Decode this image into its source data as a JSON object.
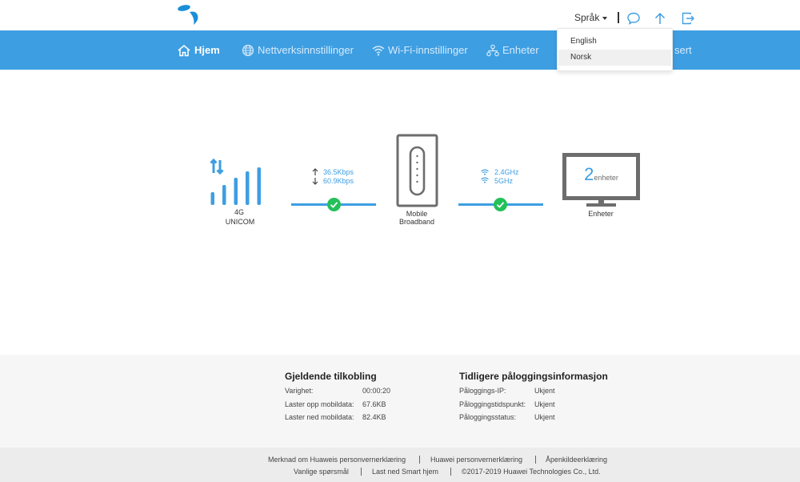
{
  "header": {
    "language_label": "Språk",
    "colors": {
      "brand": "#3e9ee2",
      "logo": "#1a8fd8"
    }
  },
  "nav": {
    "items": [
      {
        "label": "Hjem",
        "icon": "home-icon",
        "active": true
      },
      {
        "label": "Nettverksinnstillinger",
        "icon": "globe-icon"
      },
      {
        "label": "Wi-Fi-innstillinger",
        "icon": "wifi-icon"
      },
      {
        "label": "Enheter",
        "icon": "devices-icon"
      },
      {
        "label": "sert"
      }
    ]
  },
  "language_menu": {
    "options": [
      "English",
      "Norsk"
    ],
    "hovered": "Norsk"
  },
  "diagram": {
    "network": {
      "type": "4G",
      "operator": "UNICOM"
    },
    "speed": {
      "up": "36.5Kbps",
      "down": "60.9Kbps"
    },
    "router": {
      "line1": "Mobile",
      "line2": "Broadband"
    },
    "wifi": {
      "band1": "2.4GHz",
      "band2": "5GHz"
    },
    "devices": {
      "count": "2",
      "unit": "enheter",
      "label": "Enheter"
    },
    "status_color": "#24c05a"
  },
  "current_connection": {
    "title": "Gjeldende tilkobling",
    "rows": [
      {
        "key": "Varighet:",
        "value": "00:00:20"
      },
      {
        "key": "Laster opp mobildata:",
        "value": "67.6KB"
      },
      {
        "key": "Laster ned mobildata:",
        "value": "82.4KB"
      }
    ]
  },
  "previous_login": {
    "title": "Tidligere påloggingsinformasjon",
    "rows": [
      {
        "key": "Påloggings-IP:",
        "value": "Ukjent"
      },
      {
        "key": "Påloggingstidspunkt:",
        "value": "Ukjent"
      },
      {
        "key": "Påloggingsstatus:",
        "value": "Ukjent"
      }
    ]
  },
  "footer": {
    "row1": [
      "Merknad om Huaweis personvernerklæring",
      "Huawei personvernerklæring",
      "Åpenkildeerklæring"
    ],
    "row2": [
      "Vanlige spørsmål",
      "Last ned Smart hjem",
      "©2017-2019 Huawei Technologies Co., Ltd."
    ]
  }
}
